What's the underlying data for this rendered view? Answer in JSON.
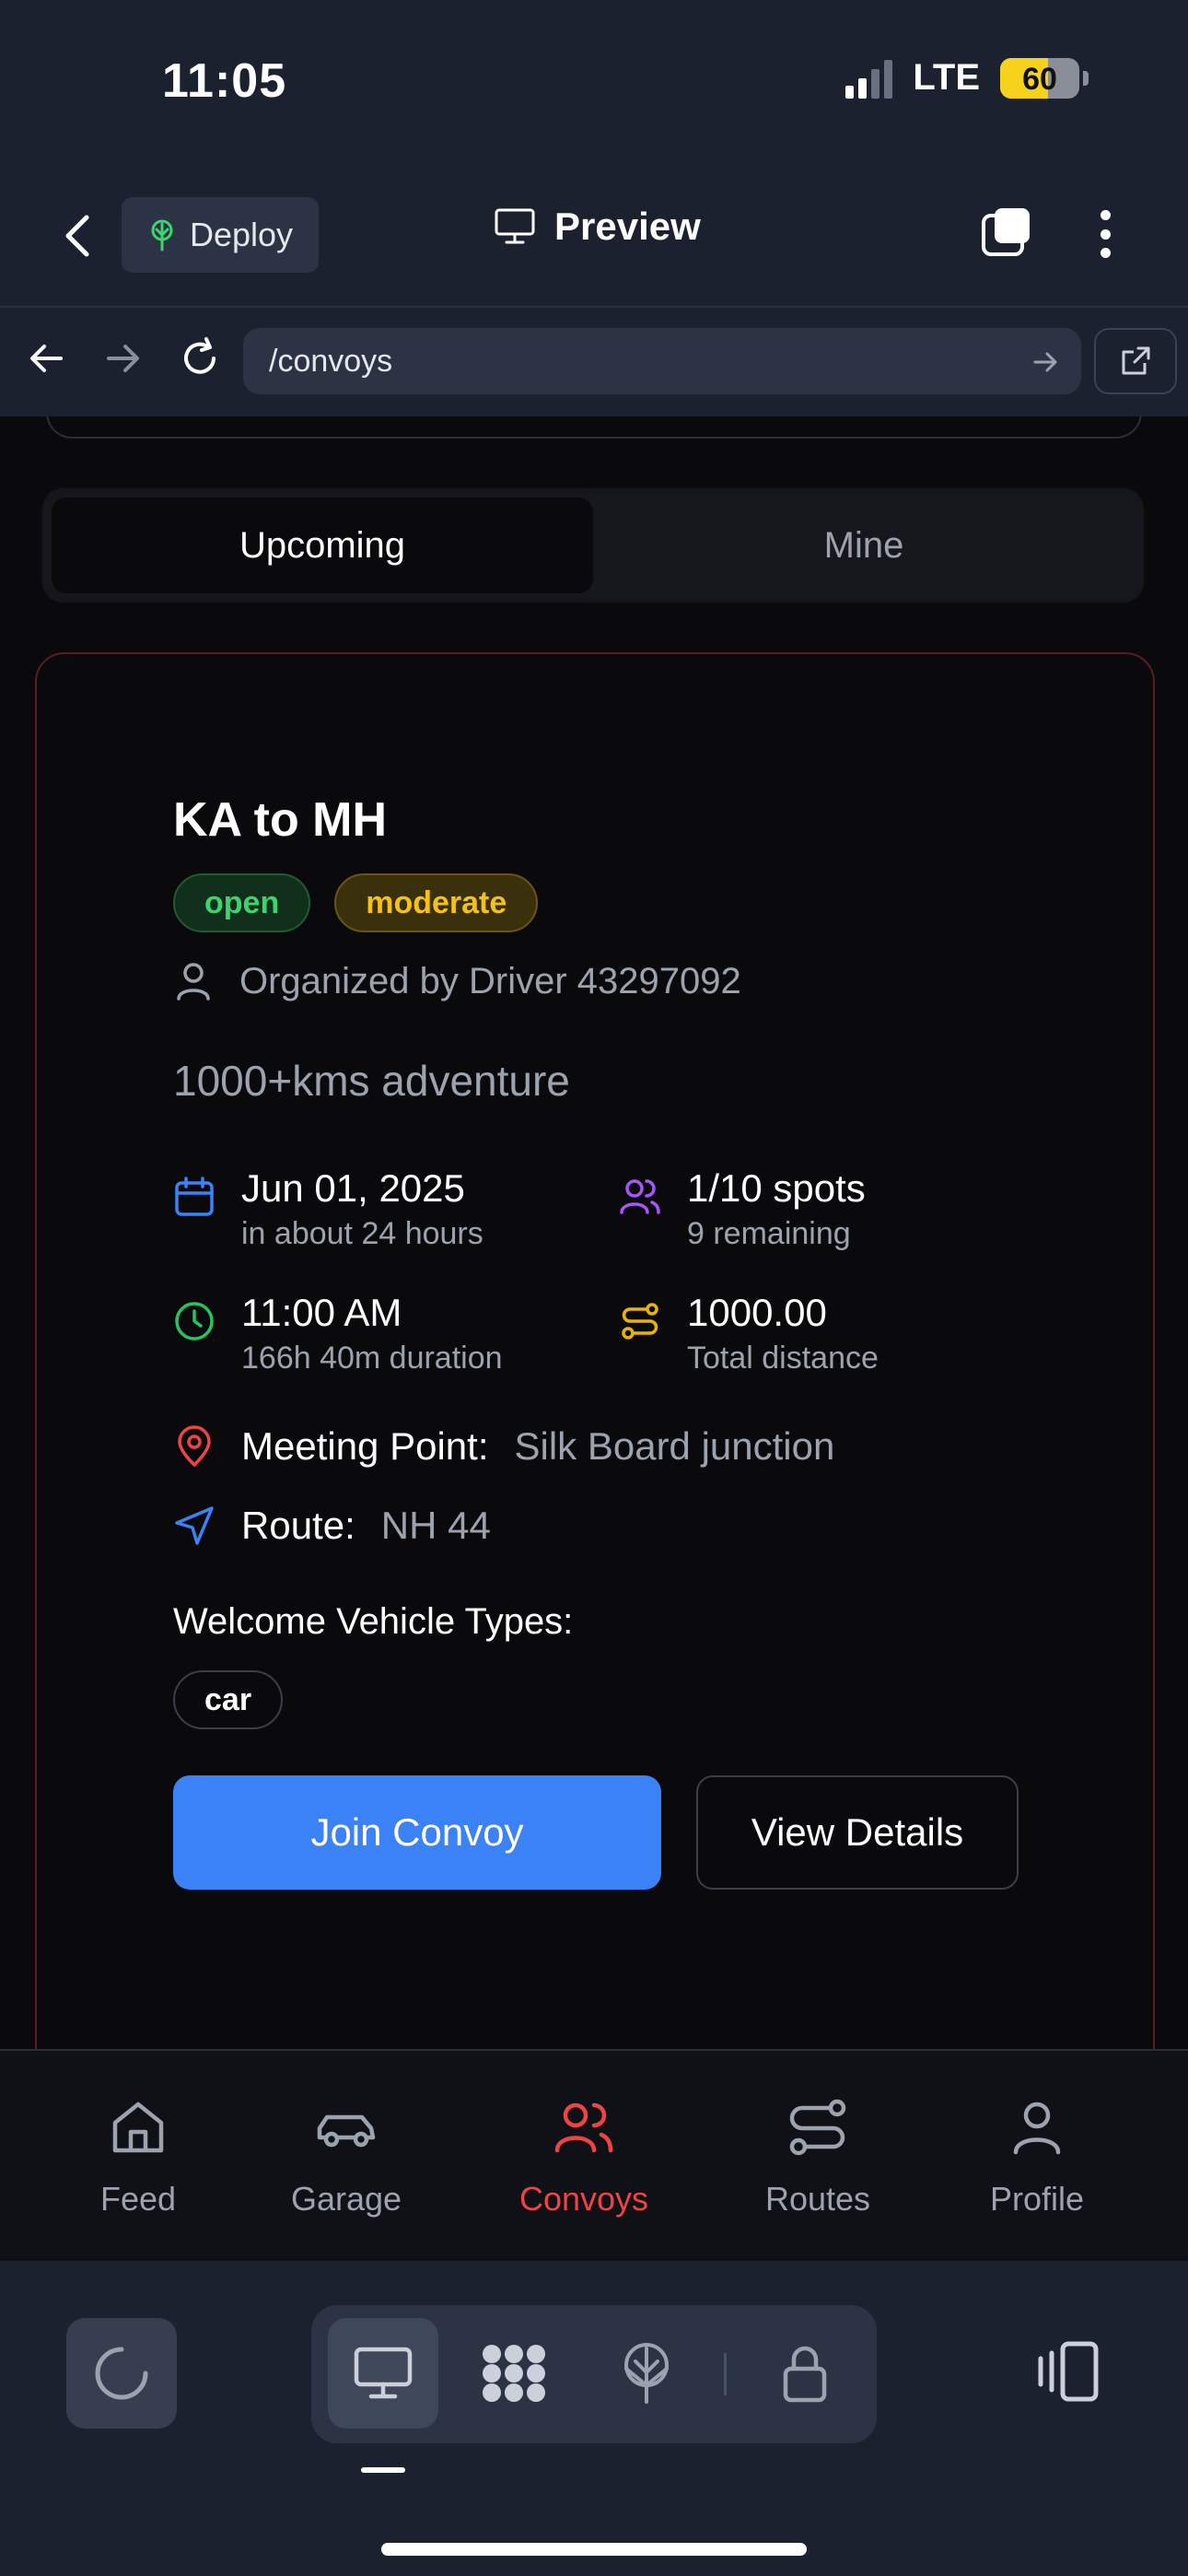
{
  "status": {
    "time": "11:05",
    "network": "LTE",
    "battery": "60"
  },
  "app_bar": {
    "deploy_label": "Deploy",
    "preview_label": "Preview"
  },
  "url_bar": {
    "path": "/convoys"
  },
  "segmented": {
    "tabs": [
      "Upcoming",
      "Mine"
    ],
    "active": "Upcoming"
  },
  "convoy": {
    "title": "KA to MH",
    "status_badge": "open",
    "difficulty_badge": "moderate",
    "organizer": "Organized by Driver 43297092",
    "description": "1000+kms adventure",
    "date": {
      "main": "Jun 01, 2025",
      "sub": "in about 24 hours"
    },
    "spots": {
      "main": "1/10 spots",
      "sub": "9 remaining"
    },
    "time": {
      "main": "11:00 AM",
      "sub": "166h 40m duration"
    },
    "distance": {
      "main": "1000.00",
      "sub": "Total distance"
    },
    "meeting_point": {
      "label": "Meeting Point:",
      "value": "Silk Board junction"
    },
    "route": {
      "label": "Route:",
      "value": "NH 44"
    },
    "vehicle_types_label": "Welcome Vehicle Types:",
    "vehicle_types": [
      "car"
    ],
    "join_label": "Join Convoy",
    "details_label": "View Details"
  },
  "tabbar": {
    "items": [
      {
        "label": "Feed",
        "icon": "home-icon"
      },
      {
        "label": "Garage",
        "icon": "car-icon"
      },
      {
        "label": "Convoys",
        "icon": "users-icon",
        "active": true
      },
      {
        "label": "Routes",
        "icon": "route-icon"
      },
      {
        "label": "Profile",
        "icon": "user-icon"
      }
    ]
  },
  "colors": {
    "accent_blue": "#3b82f6",
    "active_tab": "#ef4444",
    "open_green": "#3fd36e",
    "moderate_yellow": "#f2c21a"
  }
}
